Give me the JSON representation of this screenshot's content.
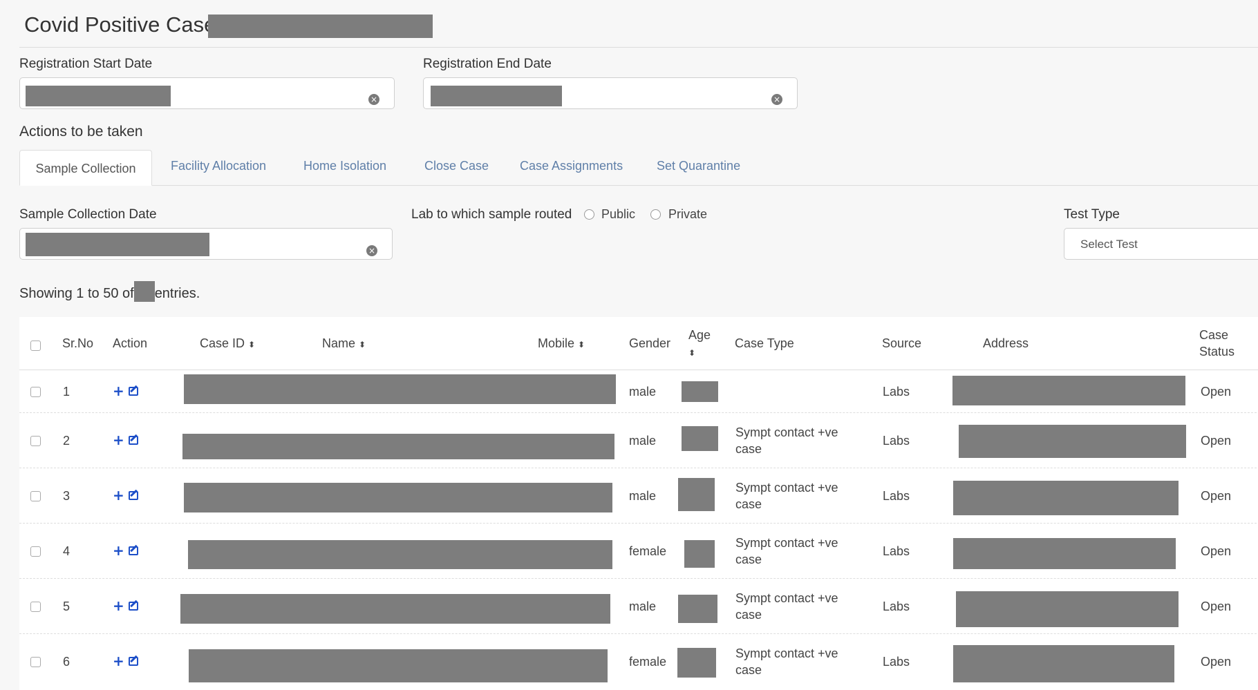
{
  "page": {
    "title": "Covid Positive Cases"
  },
  "filters": {
    "registration_start_label": "Registration Start Date",
    "registration_end_label": "Registration End Date"
  },
  "actions": {
    "heading": "Actions to be taken",
    "tabs": [
      "Sample Collection",
      "Facility Allocation",
      "Home Isolation",
      "Close Case",
      "Case Assignments",
      "Set Quarantine"
    ],
    "active_tab": "Sample Collection"
  },
  "sample_form": {
    "collection_date_label": "Sample Collection Date",
    "lab_label": "Lab to which sample routed",
    "lab_options": [
      "Public",
      "Private"
    ],
    "test_type_label": "Test Type",
    "test_type_value": "Select Test"
  },
  "summary": {
    "showing_prefix": "Showing 1 to 50 of",
    "showing_suffix": "entries."
  },
  "table": {
    "columns": {
      "sr_no": "Sr.No",
      "action": "Action",
      "case_id": "Case ID",
      "name": "Name",
      "mobile": "Mobile",
      "gender": "Gender",
      "age": "Age",
      "case_type": "Case Type",
      "source": "Source",
      "address": "Address",
      "case_status_1": "Case",
      "case_status_2": "Status"
    },
    "rows": [
      {
        "sr_no": "1",
        "gender": "male",
        "case_type_1": "",
        "case_type_2": "",
        "source": "Labs",
        "status": "Open"
      },
      {
        "sr_no": "2",
        "gender": "male",
        "case_type_1": "Sympt contact +ve",
        "case_type_2": "case",
        "source": "Labs",
        "status": "Open"
      },
      {
        "sr_no": "3",
        "gender": "male",
        "case_type_1": "Sympt contact +ve",
        "case_type_2": "case",
        "source": "Labs",
        "status": "Open"
      },
      {
        "sr_no": "4",
        "gender": "female",
        "case_type_1": "Sympt contact +ve",
        "case_type_2": "case",
        "source": "Labs",
        "status": "Open"
      },
      {
        "sr_no": "5",
        "gender": "male",
        "case_type_1": "Sympt contact +ve",
        "case_type_2": "case",
        "source": "Labs",
        "status": "Open"
      },
      {
        "sr_no": "6",
        "gender": "female",
        "case_type_1": "Sympt contact +ve",
        "case_type_2": "case",
        "source": "Labs",
        "status": "Open"
      }
    ]
  },
  "icons": {
    "sort": "sort-icon",
    "add": "plus-icon",
    "edit": "edit-icon",
    "clear": "clear-icon"
  },
  "colors": {
    "link": "#5f7fa8",
    "action_icon": "#1d4fc8",
    "redaction": "#7d7d7d"
  }
}
